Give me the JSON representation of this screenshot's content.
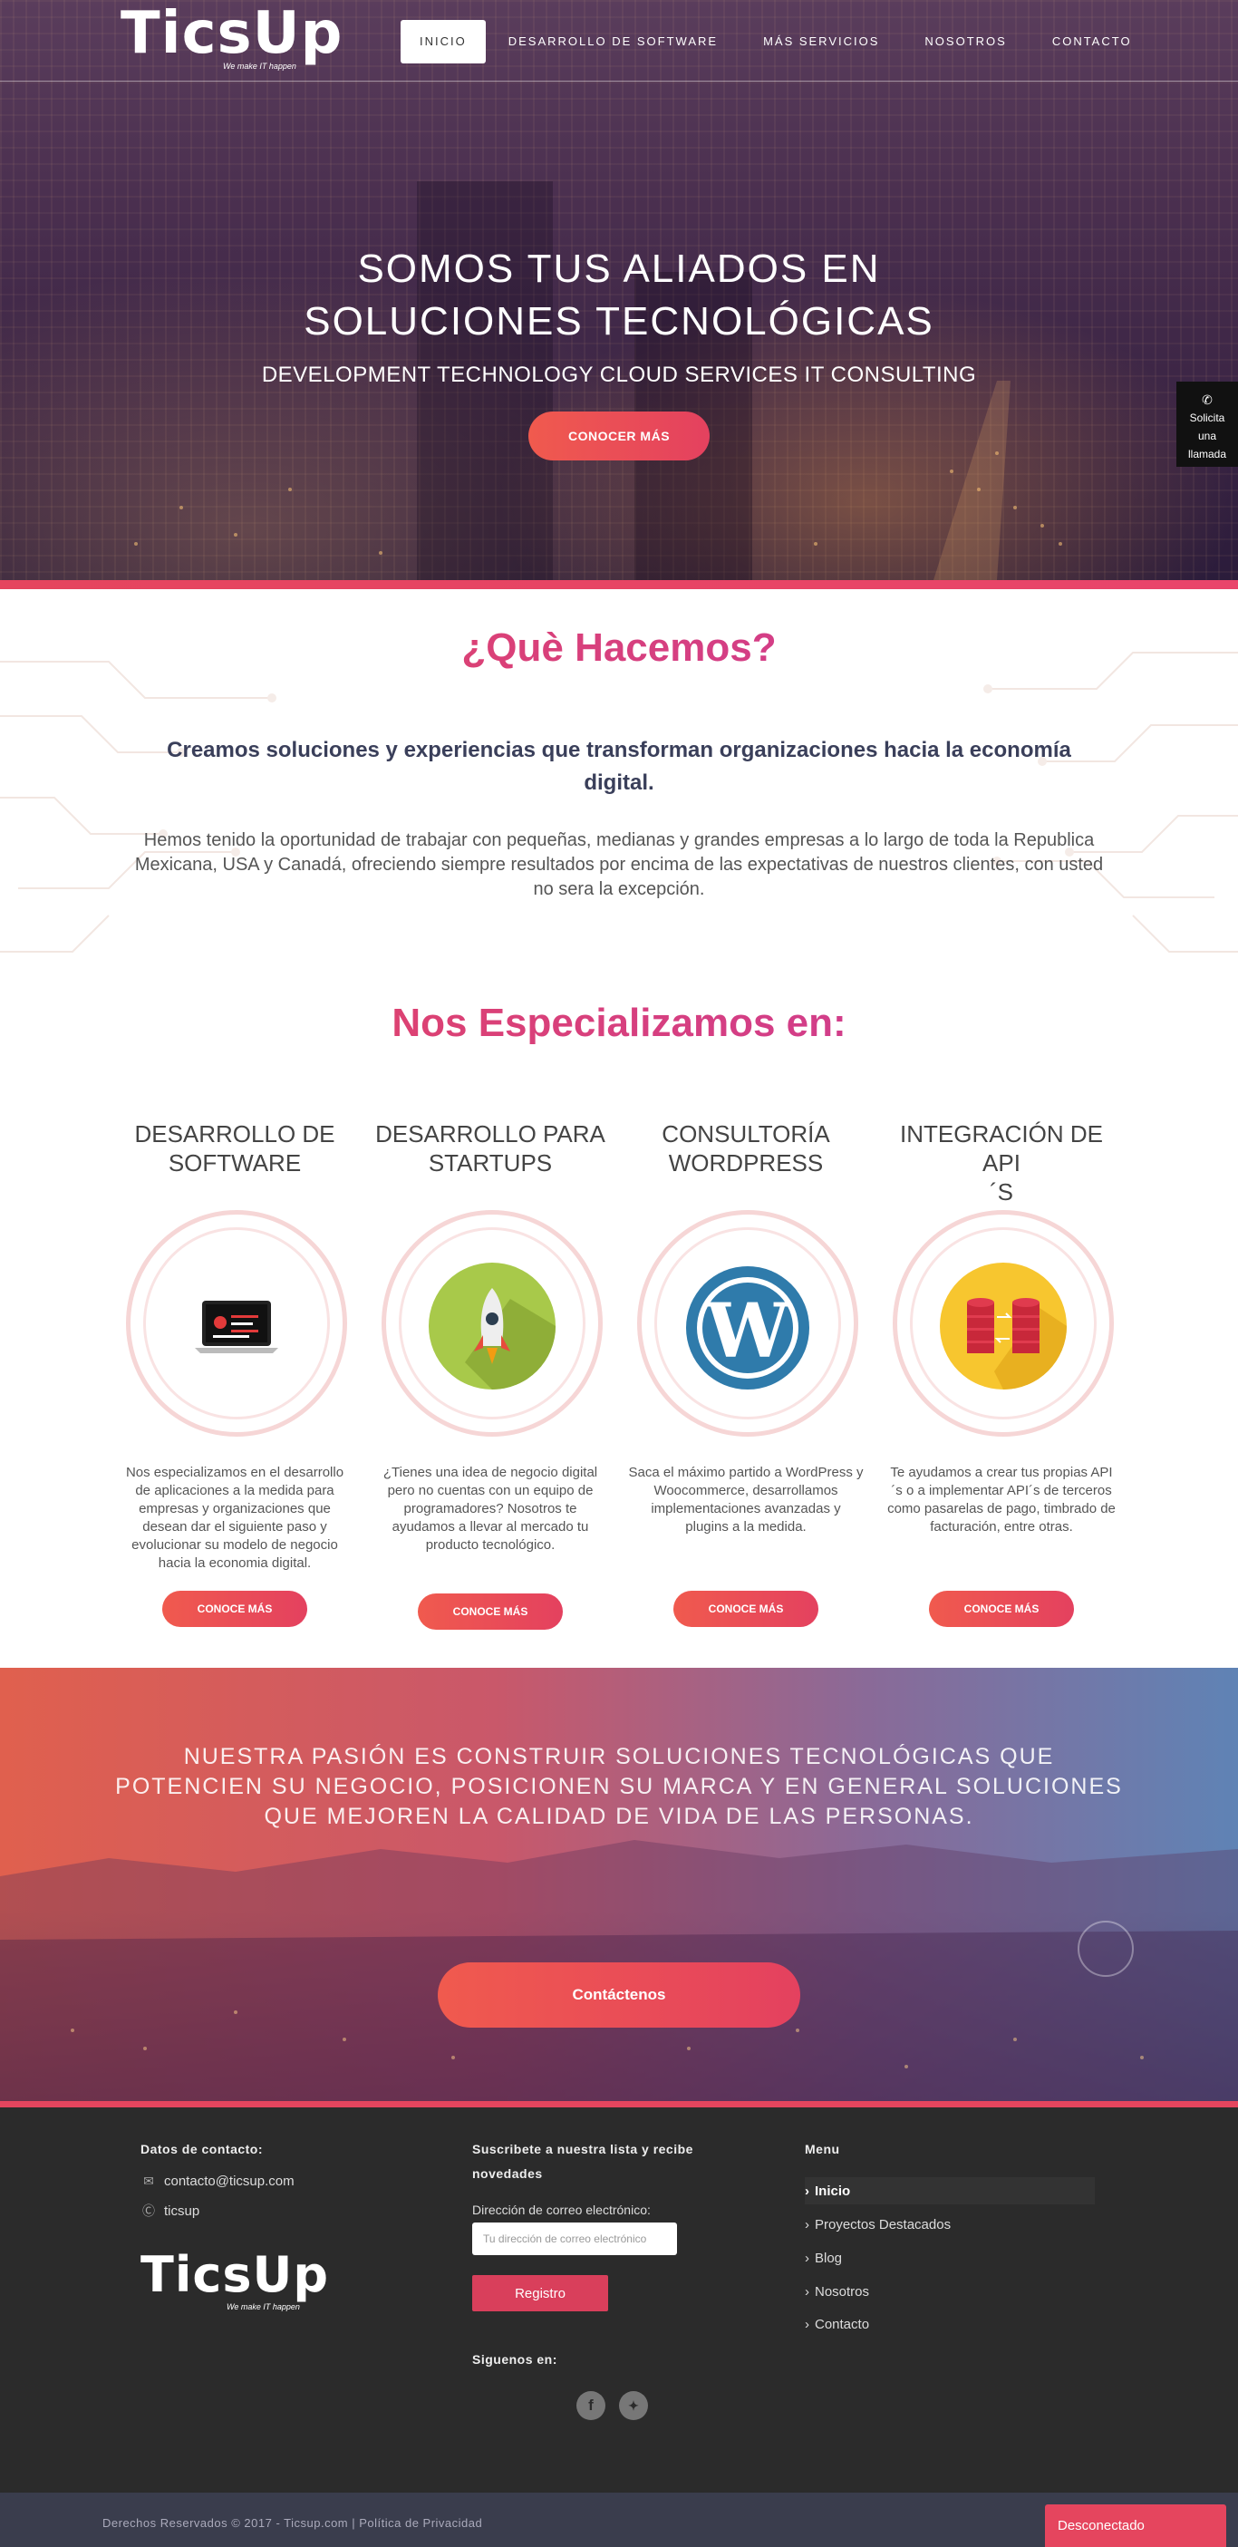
{
  "header": {
    "logo_text": "TicsUp",
    "logo_tagline": "We make IT happen",
    "nav": [
      {
        "label": "INICIO",
        "active": true
      },
      {
        "label": "DESARROLLO DE SOFTWARE"
      },
      {
        "label": "MÁS SERVICIOS"
      },
      {
        "label": "NOSOTROS"
      },
      {
        "label": "CONTACTO"
      }
    ]
  },
  "hero": {
    "title_line1": "SOMOS TUS ALIADOS EN",
    "title_line2": "SOLUCIONES TECNOLÓGICAS",
    "subtitle": "DEVELOPMENT  TECHNOLOGY  CLOUD SERVICES  IT CONSULTING",
    "cta": "CONOCER MÁS",
    "call_tab": [
      "Solicita",
      "una",
      "llamada"
    ]
  },
  "what": {
    "title": "¿Què Hacemos?",
    "lead": "Creamos soluciones y experiencias que transforman organizaciones hacia la economía digital.",
    "text": "Hemos tenido la oportunidad de trabajar con pequeñas, medianas y grandes empresas a lo largo de toda la Republica Mexicana, USA y Canadá, ofreciendo siempre resultados por encima de las expectativas de nuestros clientes, con usted no sera la excepción."
  },
  "specialize": {
    "title": "Nos Especializamos en:",
    "items": [
      {
        "title_l1": "DESARROLLO DE",
        "title_l2": "SOFTWARE",
        "desc": "Nos especializamos en el desarrollo de aplicaciones a la medida para empresas y organizaciones que desean dar el siguiente paso y evolucionar su modelo de negocio hacia la economia digital.",
        "button": "CONOCE MÁS"
      },
      {
        "title_l1": "DESARROLLO PARA",
        "title_l2": "STARTUPS",
        "desc": "¿Tienes una idea de negocio digital pero no cuentas con un equipo de programadores? Nosotros te ayudamos a llevar al mercado tu producto tecnológico.",
        "button": "CONOCE MÁS"
      },
      {
        "title_l1": "CONSULTORÍA",
        "title_l2": "WORDPRESS",
        "desc": "Saca el máximo partido a WordPress y Woocommerce, desarrollamos implementaciones avanzadas y plugins a la medida.",
        "button": "CONOCE MÁS"
      },
      {
        "title_l1": "INTEGRACIÓN DE API",
        "title_l2": "´S",
        "desc": "Te ayudamos a crear tus propias API ´s o a implementar API´s de terceros como pasarelas de pago, timbrado de facturación, entre otras.",
        "button": "CONOCE MÁS"
      }
    ]
  },
  "passion": {
    "text": "NUESTRA PASIÓN ES CONSTRUIR SOLUCIONES TECNOLÓGICAS QUE POTENCIEN SU NEGOCIO, POSICIONEN SU MARCA Y EN GENERAL SOLUCIONES QUE MEJOREN LA CALIDAD DE VIDA DE LAS PERSONAS.",
    "cta": "Contáctenos"
  },
  "footer": {
    "contact_heading": "Datos de contacto:",
    "email": "contacto@ticsup.com",
    "skype": "ticsup",
    "logo_text": "TicsUp",
    "logo_tagline": "We make IT happen",
    "newsletter_heading_l1": "Suscribete a nuestra lista y recibe",
    "newsletter_heading_l2": "novedades",
    "email_label": "Dirección de correo electrónico:",
    "email_placeholder": "Tu dirección de correo electrónico",
    "register_button": "Registro",
    "follow_heading": "Siguenos en:",
    "menu_heading": "Menu",
    "menu": [
      {
        "label": "Inicio",
        "active": true
      },
      {
        "label": "Proyectos Destacados"
      },
      {
        "label": "Blog"
      },
      {
        "label": "Nosotros"
      },
      {
        "label": "Contacto"
      }
    ],
    "copyright": "Derechos Reservados © 2017 - Ticsup.com | Política de Privacidad",
    "chat_status": "Desconectado"
  },
  "colors": {
    "accent": "#e5455e",
    "accent_purple": "#c93a9e",
    "footer_bg": "#2b2b2b"
  }
}
